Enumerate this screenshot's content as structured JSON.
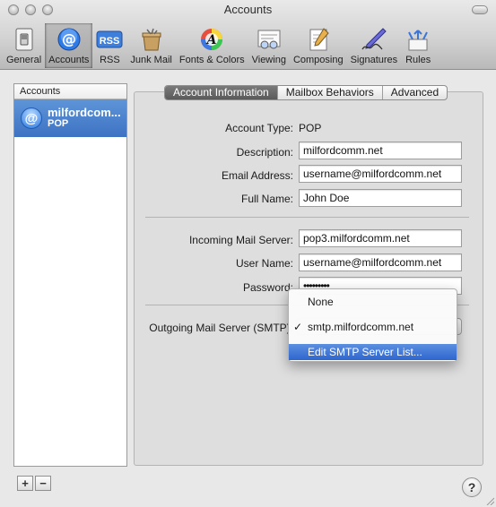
{
  "window": {
    "title": "Accounts"
  },
  "toolbar": {
    "items": [
      {
        "label": "General",
        "icon": "general-switch-icon"
      },
      {
        "label": "Accounts",
        "icon": "at-sign-icon"
      },
      {
        "label": "RSS",
        "icon": "rss-icon"
      },
      {
        "label": "Junk Mail",
        "icon": "junk-mail-icon"
      },
      {
        "label": "Fonts & Colors",
        "icon": "fonts-colors-icon"
      },
      {
        "label": "Viewing",
        "icon": "viewing-icon"
      },
      {
        "label": "Composing",
        "icon": "composing-icon"
      },
      {
        "label": "Signatures",
        "icon": "signatures-icon"
      },
      {
        "label": "Rules",
        "icon": "rules-icon"
      }
    ],
    "selected": "Accounts",
    "rss_badge": "RSS"
  },
  "sidebar": {
    "header": "Accounts",
    "accounts": [
      {
        "name": "milfordcom...",
        "type": "POP"
      }
    ],
    "add_label": "+",
    "remove_label": "−"
  },
  "tabs": [
    "Account Information",
    "Mailbox Behaviors",
    "Advanced"
  ],
  "form": {
    "account_type_label": "Account Type:",
    "account_type_value": "POP",
    "description_label": "Description:",
    "description_value": "milfordcomm.net",
    "email_label": "Email Address:",
    "email_value": "username@milfordcomm.net",
    "fullname_label": "Full Name:",
    "fullname_value": "John Doe",
    "incoming_label": "Incoming Mail Server:",
    "incoming_value": "pop3.milfordcomm.net",
    "username_label": "User Name:",
    "username_value": "username@milfordcomm.net",
    "password_label": "Password:",
    "password_value": "•••••••••",
    "outgoing_label": "Outgoing Mail Server (SMTP):"
  },
  "smtp_menu": {
    "items": [
      "None",
      "smtp.milfordcomm.net",
      "Edit SMTP Server List..."
    ],
    "checked": "smtp.milfordcomm.net",
    "highlighted": "Edit SMTP Server List..."
  },
  "help": "?",
  "colors": {
    "accent": "#3d72c3",
    "selection": "#2f66cf"
  }
}
